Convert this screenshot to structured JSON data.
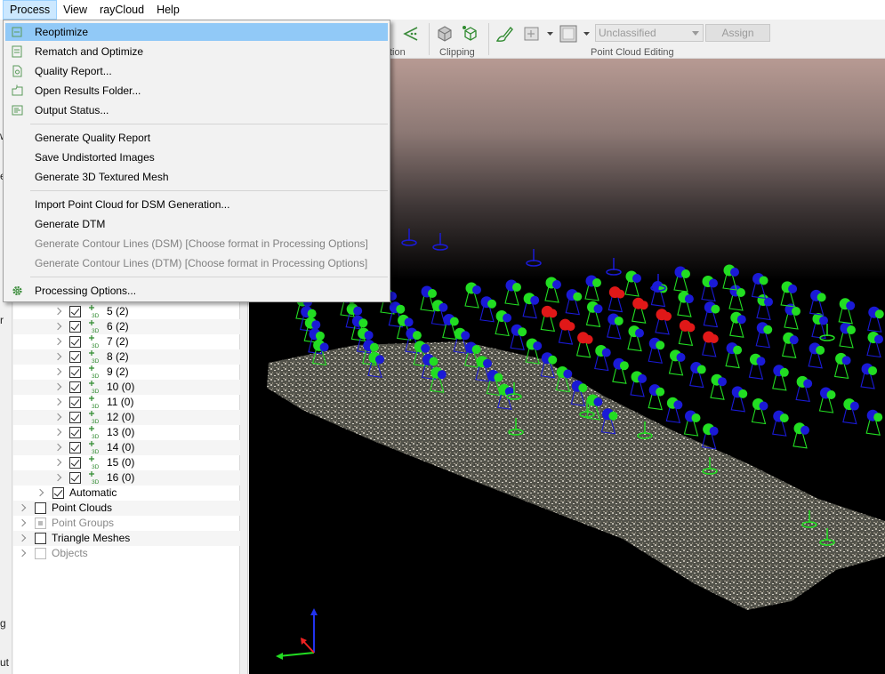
{
  "menubar": {
    "items": [
      {
        "label": "Process",
        "active": true
      },
      {
        "label": "View",
        "active": false
      },
      {
        "label": "rayCloud",
        "active": false
      },
      {
        "label": "Help",
        "active": false
      }
    ]
  },
  "process_menu": {
    "items": [
      {
        "label": "Reoptimize",
        "icon": "reoptimize-icon",
        "highlighted": true,
        "enabled": true
      },
      {
        "label": "Rematch and Optimize",
        "icon": "rematch-icon",
        "enabled": true
      },
      {
        "label": "Quality Report...",
        "icon": "report-icon",
        "enabled": true
      },
      {
        "label": "Open Results Folder...",
        "icon": "folder-icon",
        "enabled": true
      },
      {
        "label": "Output Status...",
        "icon": "status-icon",
        "enabled": true
      },
      {
        "label": "Generate Quality Report",
        "enabled": true
      },
      {
        "label": "Save Undistorted Images",
        "enabled": true
      },
      {
        "label": "Generate 3D Textured Mesh",
        "enabled": true
      },
      {
        "label": "Import Point Cloud for DSM Generation...",
        "enabled": true
      },
      {
        "label": "Generate DTM",
        "enabled": true
      },
      {
        "label": "Generate Contour Lines (DSM) [Choose format in Processing Options]",
        "enabled": false
      },
      {
        "label": "Generate Contour Lines (DTM) [Choose format in Processing Options]",
        "enabled": false
      },
      {
        "label": "Processing Options...",
        "icon": "gear-icon",
        "enabled": true
      }
    ]
  },
  "toolbar": {
    "section_partial": "tion",
    "clipping_label": "Clipping",
    "editing_label": "Point Cloud Editing",
    "class_combo_value": "Unclassified",
    "assign_label": "Assign"
  },
  "left_strip": {
    "fragments": [
      "w",
      "e",
      "r",
      "g",
      "ut"
    ]
  },
  "tree": {
    "groups": [
      {
        "label": "5 (2)"
      },
      {
        "label": "6 (2)"
      },
      {
        "label": "7 (2)"
      },
      {
        "label": "8 (2)"
      },
      {
        "label": "9 (2)"
      },
      {
        "label": "10 (0)"
      },
      {
        "label": "11 (0)"
      },
      {
        "label": "12 (0)"
      },
      {
        "label": "13 (0)"
      },
      {
        "label": "14 (0)"
      },
      {
        "label": "15 (0)"
      },
      {
        "label": "16 (0)"
      }
    ],
    "automatic_label": "Automatic",
    "top_items": [
      {
        "label": "Point Clouds",
        "enabled": true
      },
      {
        "label": "Point Groups",
        "enabled": false
      },
      {
        "label": "Triangle Meshes",
        "enabled": true
      },
      {
        "label": "Objects",
        "enabled": false
      }
    ]
  },
  "colors": {
    "camera_blue": "#1a1ad6",
    "camera_green": "#22dd22",
    "camera_red": "#e01818",
    "menu_highlight": "#91c9f7"
  }
}
